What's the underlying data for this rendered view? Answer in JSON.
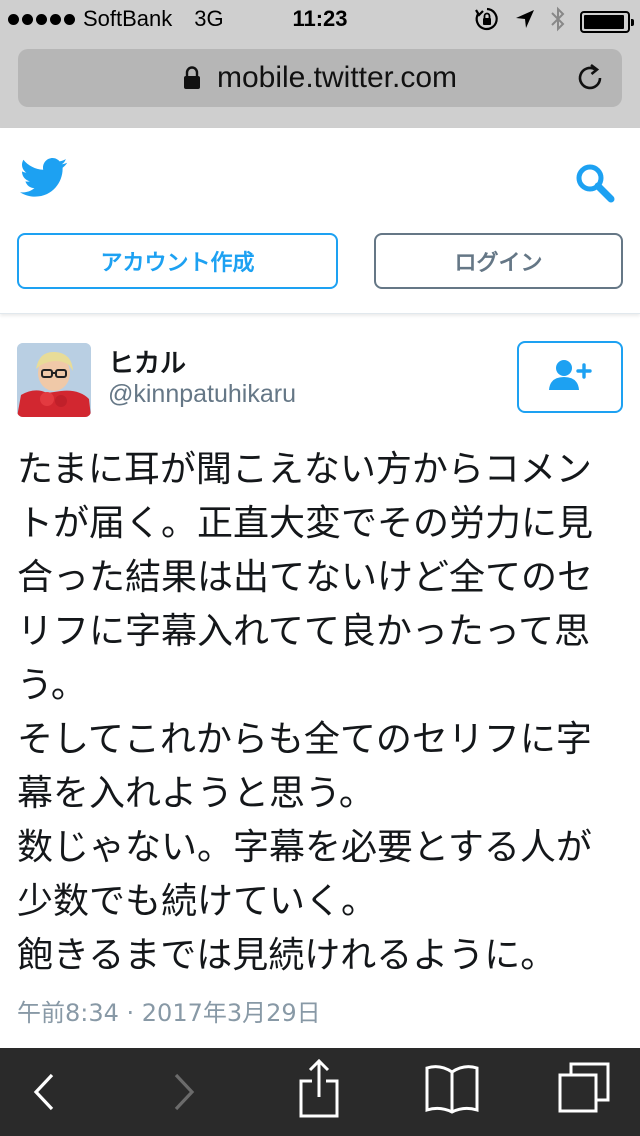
{
  "status_bar": {
    "carrier": "SoftBank",
    "network": "3G",
    "time": "11:23",
    "icons": [
      "signal-dots-icon",
      "orientation-lock-icon",
      "location-arrow-icon",
      "bluetooth-icon",
      "battery-icon"
    ],
    "battery_level": 0.95
  },
  "browser": {
    "url": "mobile.twitter.com",
    "icons": [
      "lock-icon",
      "reload-icon"
    ]
  },
  "header": {
    "logo_icon": "twitter-bird-icon",
    "search_icon": "search-icon",
    "signup_label": "アカウント作成",
    "login_label": "ログイン",
    "accent_color": "#1da1f2"
  },
  "tweet": {
    "display_name": "ヒカル",
    "handle": "@kinnpatuhikaru",
    "follow_icon": "add-user-icon",
    "text": "たまに耳が聞こえない方からコメントが届く。正直大変でその労力に見合った結果は出てないけど全てのセリフに字幕入れてて良かったって思う。\nそしてこれからも全てのセリフに字幕を入れようと思う。\n数じゃない。字幕を必要とする人が少数でも続けていく。\n飽きるまでは見続けれるように。",
    "timestamp": "午前8:34 · 2017年3月29日"
  },
  "toolbar": {
    "icons": [
      "back-icon",
      "forward-icon",
      "share-icon",
      "bookmarks-icon",
      "tabs-icon"
    ]
  }
}
